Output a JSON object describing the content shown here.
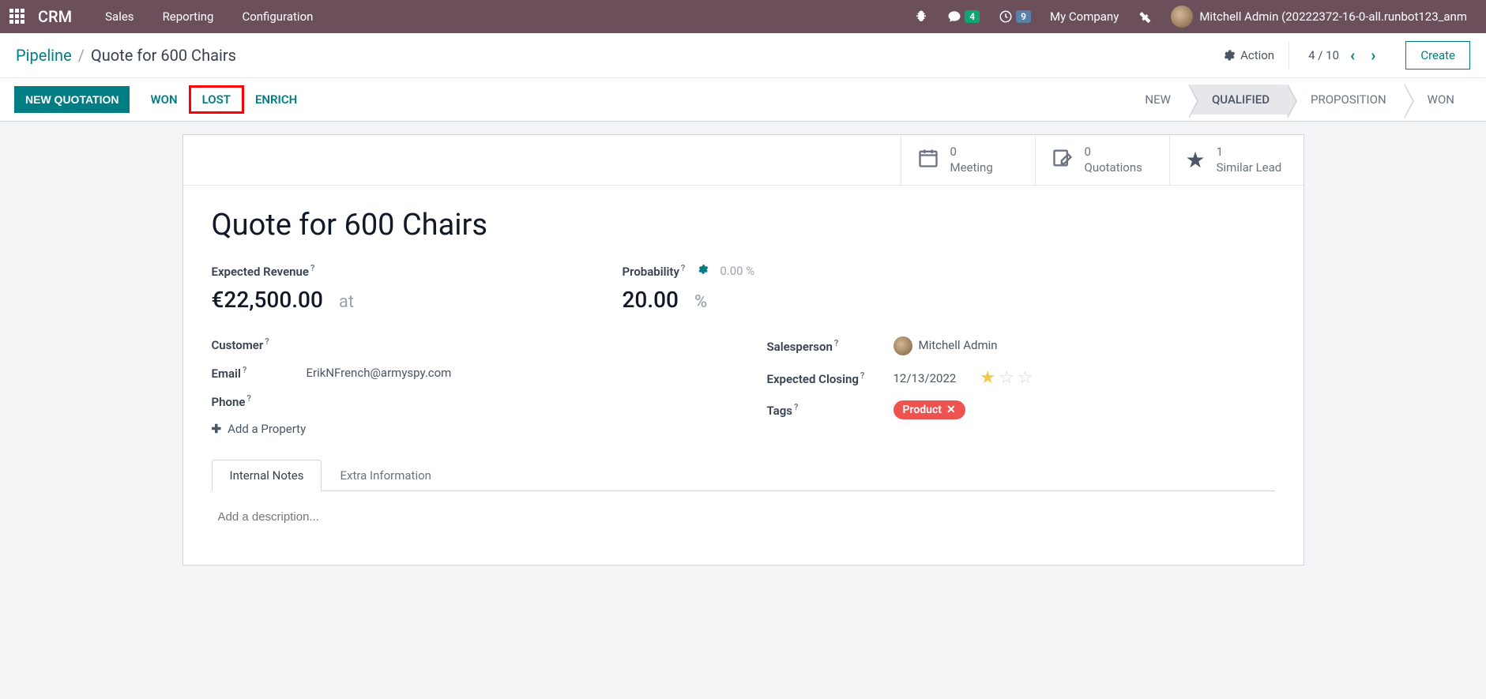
{
  "navbar": {
    "brand": "CRM",
    "menu": [
      "Sales",
      "Reporting",
      "Configuration"
    ],
    "messaging_badge": "4",
    "activity_badge": "9",
    "company": "My Company",
    "user": "Mitchell Admin (20222372-16-0-all.runbot123_anm"
  },
  "breadcrumb": {
    "root": "Pipeline",
    "current": "Quote for 600 Chairs",
    "action_label": "Action",
    "pager": "4 / 10",
    "create_label": "Create"
  },
  "actions": {
    "new_quotation": "NEW QUOTATION",
    "won": "WON",
    "lost": "LOST",
    "enrich": "ENRICH",
    "stages": [
      "NEW",
      "QUALIFIED",
      "PROPOSITION",
      "WON"
    ],
    "active_stage_index": 1
  },
  "stat_buttons": {
    "meeting": {
      "count": "0",
      "label": "Meeting"
    },
    "quotations": {
      "count": "0",
      "label": "Quotations"
    },
    "similar": {
      "count": "1",
      "label": "Similar Lead"
    }
  },
  "record": {
    "title": "Quote for 600 Chairs",
    "expected_revenue_label": "Expected Revenue",
    "expected_revenue": "€22,500.00",
    "at_label": "at",
    "probability_label": "Probability",
    "probability": "20.00",
    "auto_probability": "0.00 %",
    "percent_sign": "%",
    "customer_label": "Customer",
    "customer": "",
    "email_label": "Email",
    "email": "ErikNFrench@armyspy.com",
    "phone_label": "Phone",
    "phone": "",
    "salesperson_label": "Salesperson",
    "salesperson": "Mitchell Admin",
    "expected_closing_label": "Expected Closing",
    "expected_closing": "12/13/2022",
    "tags_label": "Tags",
    "tag": "Product",
    "priority": 1,
    "add_property": "Add a Property"
  },
  "tabs": {
    "internal_notes": "Internal Notes",
    "extra_info": "Extra Information",
    "description_placeholder": "Add a description..."
  }
}
